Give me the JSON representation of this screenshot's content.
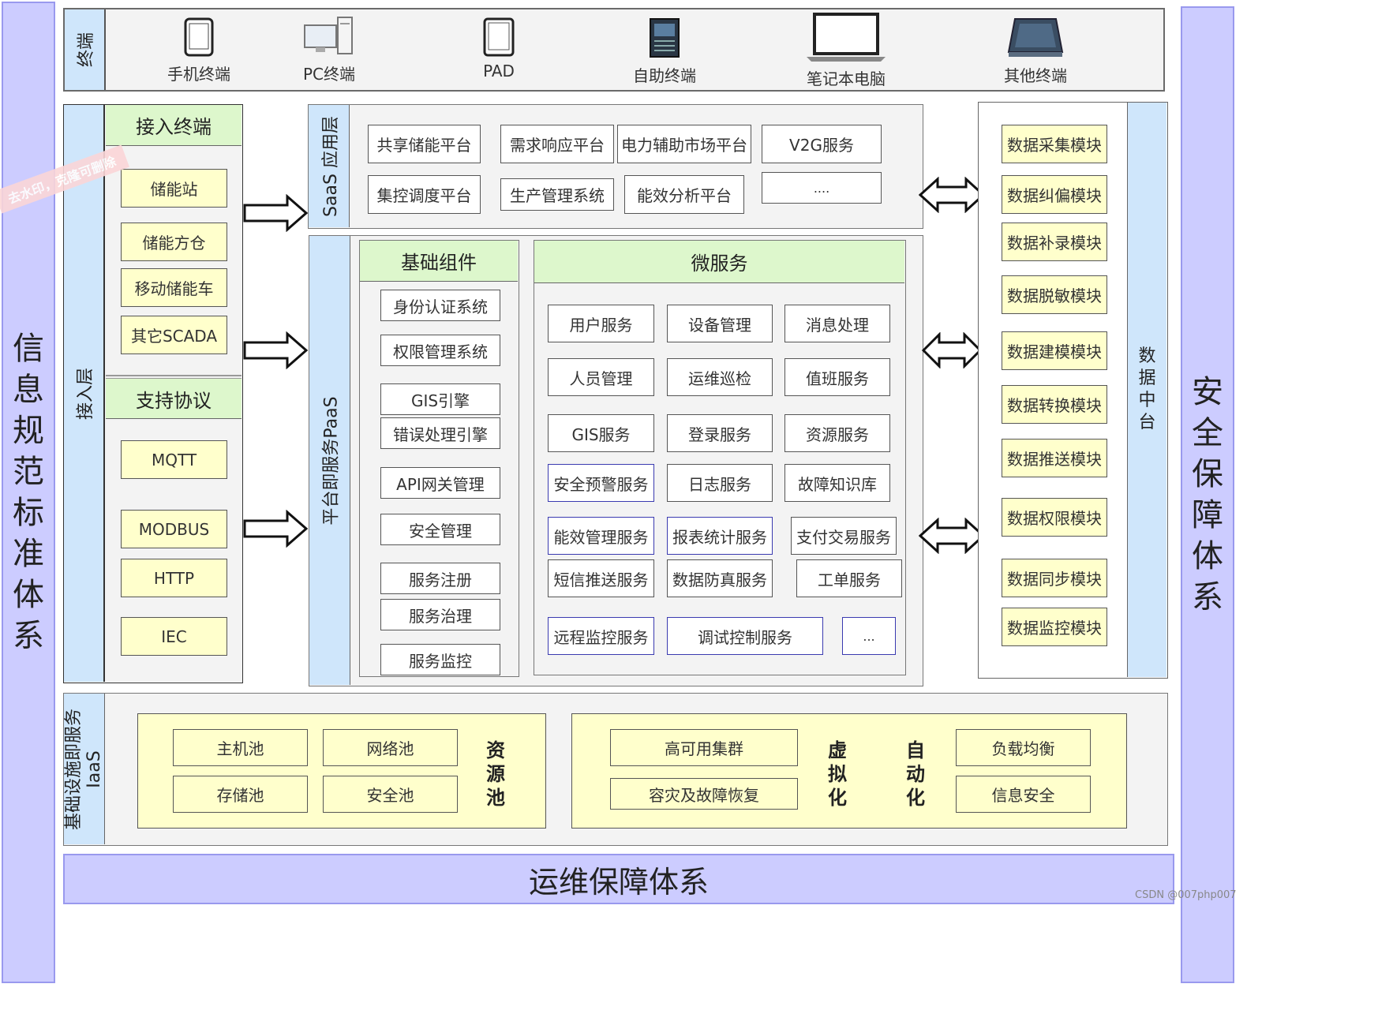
{
  "left_band": "信息规范标准体系",
  "right_band": "安全保障体系",
  "bottom_band": "运维保障体系",
  "terminal": {
    "label": "终端",
    "devices": [
      {
        "label": "手机终端",
        "icon": "phone-icon"
      },
      {
        "label": "PC终端",
        "icon": "pc-icon"
      },
      {
        "label": "PAD",
        "icon": "tablet-icon"
      },
      {
        "label": "自助终端",
        "icon": "kiosk-icon"
      },
      {
        "label": "笔记本电脑",
        "icon": "laptop-icon"
      },
      {
        "label": "其他终端",
        "icon": "scanner-icon"
      }
    ]
  },
  "access": {
    "label": "接入层",
    "terminals_title": "接入终端",
    "terminals": [
      "储能站",
      "储能方仓",
      "移动储能车",
      "其它SCADA"
    ],
    "protocols_title": "支持协议",
    "protocols": [
      "MQTT",
      "MODBUS",
      "HTTP",
      "IEC"
    ]
  },
  "saas": {
    "label": "SaaS 应用层",
    "items": [
      "共享储能平台",
      "需求响应平台",
      "电力辅助市场平台",
      "V2G服务",
      "集控调度平台",
      "生产管理系统",
      "能效分析平台",
      "...."
    ]
  },
  "paas": {
    "label": "平台即服务PaaS",
    "base_title": "基础组件",
    "base": [
      "身份认证系统",
      "权限管理系统",
      "GIS引擎",
      "错误处理引擎",
      "API网关管理",
      "安全管理",
      "服务注册",
      "服务治理",
      "服务监控"
    ],
    "micro_title": "微服务",
    "micro": [
      "用户服务",
      "设备管理",
      "消息处理",
      "人员管理",
      "运维巡检",
      "值班服务",
      "GIS服务",
      "登录服务",
      "资源服务",
      "安全预警服务",
      "日志服务",
      "故障知识库",
      "能效管理服务",
      "报表统计服务",
      "支付交易服务",
      "短信推送服务",
      "数据防真服务",
      "工单服务",
      "远程监控服务",
      "调试控制服务",
      "..."
    ]
  },
  "data_center": {
    "label": "数据中台",
    "modules": [
      "数据采集模块",
      "数据纠偏模块",
      "数据补录模块",
      "数据脱敏模块",
      "数据建模模块",
      "数据转换模块",
      "数据推送模块",
      "数据权限模块",
      "数据同步模块",
      "数据监控模块"
    ]
  },
  "iaas": {
    "label_line1": "基础设施即服务",
    "label_line2": "IaaS",
    "pools": [
      "主机池",
      "网络池",
      "存储池",
      "安全池"
    ],
    "pool_title": "资源池",
    "virt_left": [
      "高可用集群",
      "容灾及故障恢复"
    ],
    "virt_title": "虚拟化",
    "auto_title": "自动化",
    "virt_right": [
      "负载均衡",
      "信息安全"
    ]
  },
  "watermark": "去水印，克隆可删除",
  "credit": "CSDN @007php007",
  "colors": {
    "band": "#ccccff",
    "label_bar": "#cfe6fb",
    "yellow": "#ffffcc",
    "green": "#ddf7cc",
    "panel": "#f3f3f3"
  }
}
